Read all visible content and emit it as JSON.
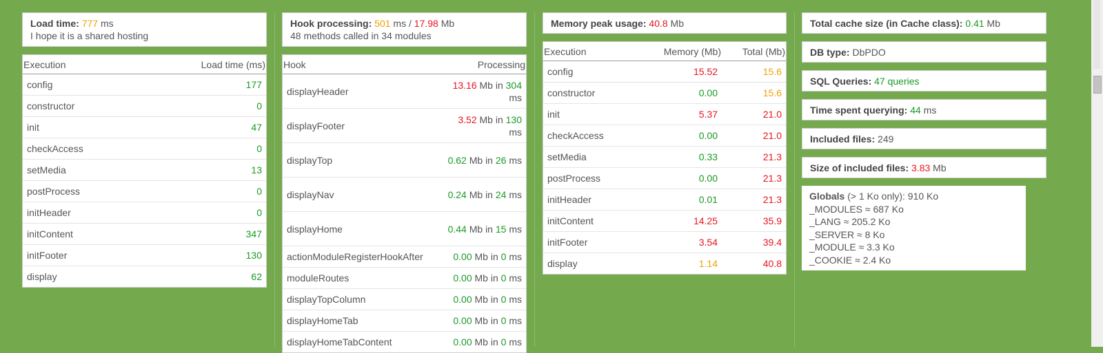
{
  "load": {
    "label": "Load time",
    "value": "777",
    "unit": "ms",
    "note": "I hope it is a shared hosting",
    "table_headers": [
      "Execution",
      "Load time (ms)"
    ],
    "rows": [
      {
        "name": "config",
        "value": "177"
      },
      {
        "name": "constructor",
        "value": "0"
      },
      {
        "name": "init",
        "value": "47"
      },
      {
        "name": "checkAccess",
        "value": "0"
      },
      {
        "name": "setMedia",
        "value": "13"
      },
      {
        "name": "postProcess",
        "value": "0"
      },
      {
        "name": "initHeader",
        "value": "0"
      },
      {
        "name": "initContent",
        "value": "347"
      },
      {
        "name": "initFooter",
        "value": "130"
      },
      {
        "name": "display",
        "value": "62"
      }
    ]
  },
  "hooks": {
    "label": "Hook processing",
    "ms": "501",
    "ms_unit": "ms /",
    "mb": "17.98",
    "mb_unit": "Mb",
    "note": "48 methods called in 34 modules",
    "table_headers": [
      "Hook",
      "Processing"
    ],
    "unit_mb": "Mb in",
    "unit_ms": "ms",
    "rows": [
      {
        "name": "displayHeader",
        "mb": "13.16",
        "ms": "304",
        "mb_color": "#e8141e",
        "ms_color": "#199a23"
      },
      {
        "name": "displayFooter",
        "mb": "3.52",
        "ms": "130",
        "mb_color": "#e8141e",
        "ms_color": "#199a23"
      },
      {
        "name": "displayTop",
        "mb": "0.62",
        "ms": "26",
        "mb_color": "#199a23",
        "ms_color": "#199a23"
      },
      {
        "name": "displayNav",
        "mb": "0.24",
        "ms": "24",
        "mb_color": "#199a23",
        "ms_color": "#199a23"
      },
      {
        "name": "displayHome",
        "mb": "0.44",
        "ms": "15",
        "mb_color": "#199a23",
        "ms_color": "#199a23"
      },
      {
        "name": "actionModuleRegisterHookAfter",
        "mb": "0.00",
        "ms": "0",
        "mb_color": "#199a23",
        "ms_color": "#199a23"
      },
      {
        "name": "moduleRoutes",
        "mb": "0.00",
        "ms": "0",
        "mb_color": "#199a23",
        "ms_color": "#199a23"
      },
      {
        "name": "displayTopColumn",
        "mb": "0.00",
        "ms": "0",
        "mb_color": "#199a23",
        "ms_color": "#199a23"
      },
      {
        "name": "displayHomeTab",
        "mb": "0.00",
        "ms": "0",
        "mb_color": "#199a23",
        "ms_color": "#199a23"
      },
      {
        "name": "displayHomeTabContent",
        "mb": "0.00",
        "ms": "0",
        "mb_color": "#199a23",
        "ms_color": "#199a23"
      }
    ]
  },
  "memory": {
    "label": "Memory peak usage",
    "value": "40.8",
    "unit": "Mb",
    "table_headers": [
      "Execution",
      "Memory (Mb)",
      "Total (Mb)"
    ],
    "rows": [
      {
        "name": "config",
        "mem": "15.52",
        "total": "15.6",
        "mem_color": "#e8141e",
        "total_color": "#f2a000"
      },
      {
        "name": "constructor",
        "mem": "0.00",
        "total": "15.6",
        "mem_color": "#199a23",
        "total_color": "#f2a000"
      },
      {
        "name": "init",
        "mem": "5.37",
        "total": "21.0",
        "mem_color": "#e8141e",
        "total_color": "#e8141e"
      },
      {
        "name": "checkAccess",
        "mem": "0.00",
        "total": "21.0",
        "mem_color": "#199a23",
        "total_color": "#e8141e"
      },
      {
        "name": "setMedia",
        "mem": "0.33",
        "total": "21.3",
        "mem_color": "#199a23",
        "total_color": "#e8141e"
      },
      {
        "name": "postProcess",
        "mem": "0.00",
        "total": "21.3",
        "mem_color": "#199a23",
        "total_color": "#e8141e"
      },
      {
        "name": "initHeader",
        "mem": "0.01",
        "total": "21.3",
        "mem_color": "#199a23",
        "total_color": "#e8141e"
      },
      {
        "name": "initContent",
        "mem": "14.25",
        "total": "35.9",
        "mem_color": "#e8141e",
        "total_color": "#e8141e"
      },
      {
        "name": "initFooter",
        "mem": "3.54",
        "total": "39.4",
        "mem_color": "#e8141e",
        "total_color": "#e8141e"
      },
      {
        "name": "display",
        "mem": "1.14",
        "total": "40.8",
        "mem_color": "#f2a000",
        "total_color": "#e8141e"
      }
    ]
  },
  "stats": {
    "cache_label": "Total cache size (in Cache class)",
    "cache_value": "0.41",
    "cache_unit": "Mb",
    "db_label": "DB type",
    "db_value": "DbPDO",
    "sql_label": "SQL Queries",
    "sql_value": "47 queries",
    "time_label": "Time spent querying",
    "time_value": "44",
    "time_unit": "ms",
    "files_label": "Included files",
    "files_value": "249",
    "size_label": "Size of included files",
    "size_value": "3.83",
    "size_unit": "Mb",
    "globals_label": "Globals",
    "globals_note": "(> 1 Ko only): 910 Ko",
    "globals": [
      "_MODULES ≈ 687 Ko",
      "_LANG ≈ 205.2 Ko",
      "_SERVER ≈ 8 Ko",
      "_MODULE ≈ 3.3 Ko",
      "_COOKIE ≈ 2.4 Ko"
    ]
  },
  "colors": {
    "background": "#74a94d",
    "red": "#e8141e",
    "green": "#199a23",
    "orange": "#f2a000"
  }
}
